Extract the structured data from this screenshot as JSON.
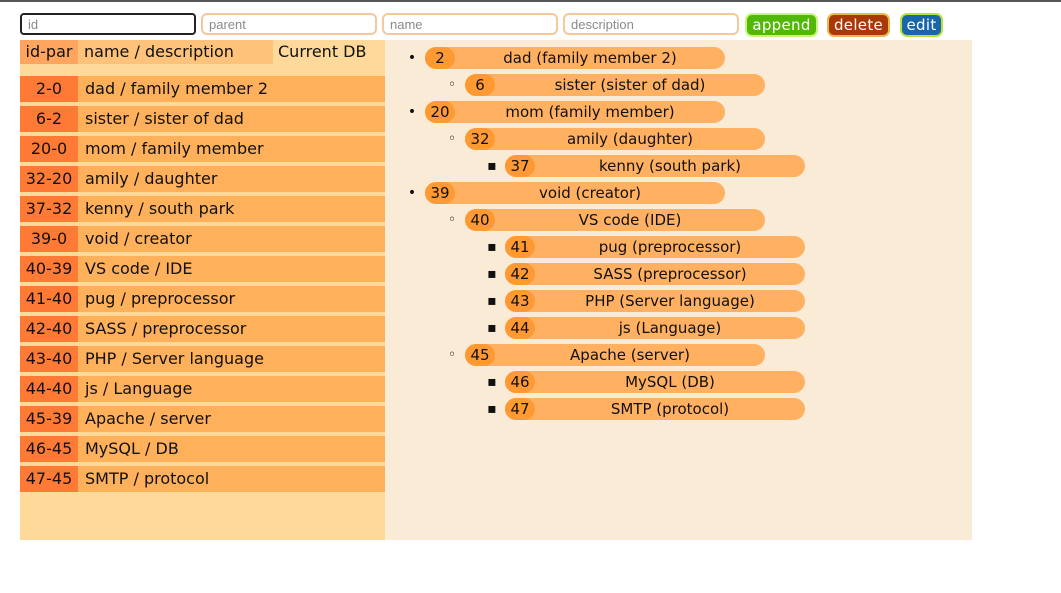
{
  "form": {
    "id_value": "",
    "id_placeholder": "id",
    "parent_placeholder": "parent",
    "name_placeholder": "name",
    "description_placeholder": "description",
    "append_label": "append",
    "delete_label": "delete",
    "edit_label": "edit"
  },
  "left": {
    "header": {
      "id_par": "id-par",
      "name_desc": "name / description",
      "current_db": "Current DB"
    },
    "rows": [
      {
        "idpar": "2-0",
        "text": "dad / family member 2"
      },
      {
        "idpar": "6-2",
        "text": "sister / sister of dad"
      },
      {
        "idpar": "20-0",
        "text": "mom / family member"
      },
      {
        "idpar": "32-20",
        "text": "amily / daughter"
      },
      {
        "idpar": "37-32",
        "text": "kenny / south park"
      },
      {
        "idpar": "39-0",
        "text": "void / creator"
      },
      {
        "idpar": "40-39",
        "text": "VS code / IDE"
      },
      {
        "idpar": "41-40",
        "text": "pug / preprocessor"
      },
      {
        "idpar": "42-40",
        "text": "SASS / preprocessor"
      },
      {
        "idpar": "43-40",
        "text": "PHP / Server language"
      },
      {
        "idpar": "44-40",
        "text": "js / Language"
      },
      {
        "idpar": "45-39",
        "text": "Apache / server"
      },
      {
        "idpar": "46-45",
        "text": "MySQL / DB"
      },
      {
        "idpar": "47-45",
        "text": "SMTP / protocol"
      }
    ]
  },
  "tree": [
    {
      "id": "2",
      "label": "dad (family member 2)",
      "depth": 0
    },
    {
      "id": "6",
      "label": "sister (sister of dad)",
      "depth": 1
    },
    {
      "id": "20",
      "label": "mom (family member)",
      "depth": 0
    },
    {
      "id": "32",
      "label": "amily (daughter)",
      "depth": 1
    },
    {
      "id": "37",
      "label": "kenny (south park)",
      "depth": 2
    },
    {
      "id": "39",
      "label": "void (creator)",
      "depth": 0
    },
    {
      "id": "40",
      "label": "VS code (IDE)",
      "depth": 1
    },
    {
      "id": "41",
      "label": "pug (preprocessor)",
      "depth": 2
    },
    {
      "id": "42",
      "label": "SASS (preprocessor)",
      "depth": 2
    },
    {
      "id": "43",
      "label": "PHP (Server language)",
      "depth": 2
    },
    {
      "id": "44",
      "label": "js (Language)",
      "depth": 2
    },
    {
      "id": "45",
      "label": "Apache (server)",
      "depth": 1
    },
    {
      "id": "46",
      "label": "MySQL (DB)",
      "depth": 2
    },
    {
      "id": "47",
      "label": "SMTP (protocol)",
      "depth": 2
    }
  ],
  "bullets": [
    "•",
    "◦",
    "▪"
  ]
}
